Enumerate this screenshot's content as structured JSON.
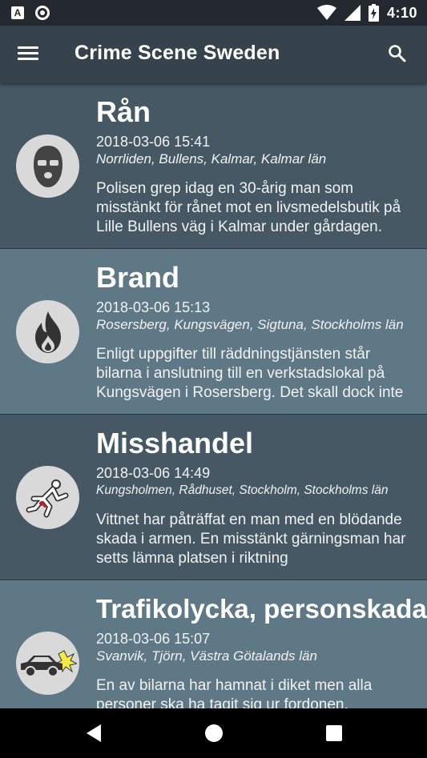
{
  "status_bar": {
    "a_badge": "A",
    "time": "4:10",
    "icons": [
      "a-notification-icon",
      "record-icon",
      "wifi-icon",
      "signal-icon",
      "battery-charging-icon"
    ]
  },
  "app_bar": {
    "title": "Crime Scene Sweden",
    "icons": [
      "hamburger-menu-icon",
      "search-icon"
    ]
  },
  "colors": {
    "status_bar": "#23292e",
    "app_bar": "#37434c",
    "item_dark": "#455863",
    "item_light": "#5f7885",
    "icon_circle": "#d9d9d9"
  },
  "events": [
    {
      "title": "Rån",
      "time": "2018-03-06 15:41",
      "place": "Norrliden, Bullens, Kalmar, Kalmar län",
      "description": "Polisen grep idag en 30-årig man som misstänkt för rånet mot en livsmedelsbutik på Lille Bullens väg i Kalmar under gårdagen.",
      "icon": "balaclava-mask-icon"
    },
    {
      "title": "Brand",
      "time": "2018-03-06 15:13",
      "place": "Rosersberg, Kungsvägen, Sigtuna, Stockholms län",
      "description": "Enligt uppgifter till räddningstjänsten står bilarna i anslutning till en verkstadslokal på Kungsvägen i Rosersberg. Det skall dock inte",
      "icon": "flame-icon"
    },
    {
      "title": "Misshandel",
      "time": "2018-03-06 14:49",
      "place": "Kungsholmen, Rådhuset, Stockholm, Stockholms län",
      "description": "Vittnet har påträffat en man med en blödande skada i armen. En misstänkt gärningsman har setts lämna platsen i riktning",
      "icon": "assault-figure-icon"
    },
    {
      "title": "Trafikolycka,  personskada",
      "time": "2018-03-06 15:07",
      "place": "Svanvik, Tjörn, Västra Götalands län",
      "description": "En av bilarna har hamnat i diket men alla personer ska ha tagit sig ur fordonen.",
      "icon": "car-crash-icon"
    }
  ],
  "nav_bar": {
    "icons": [
      "back-icon",
      "home-icon",
      "recents-icon"
    ]
  }
}
